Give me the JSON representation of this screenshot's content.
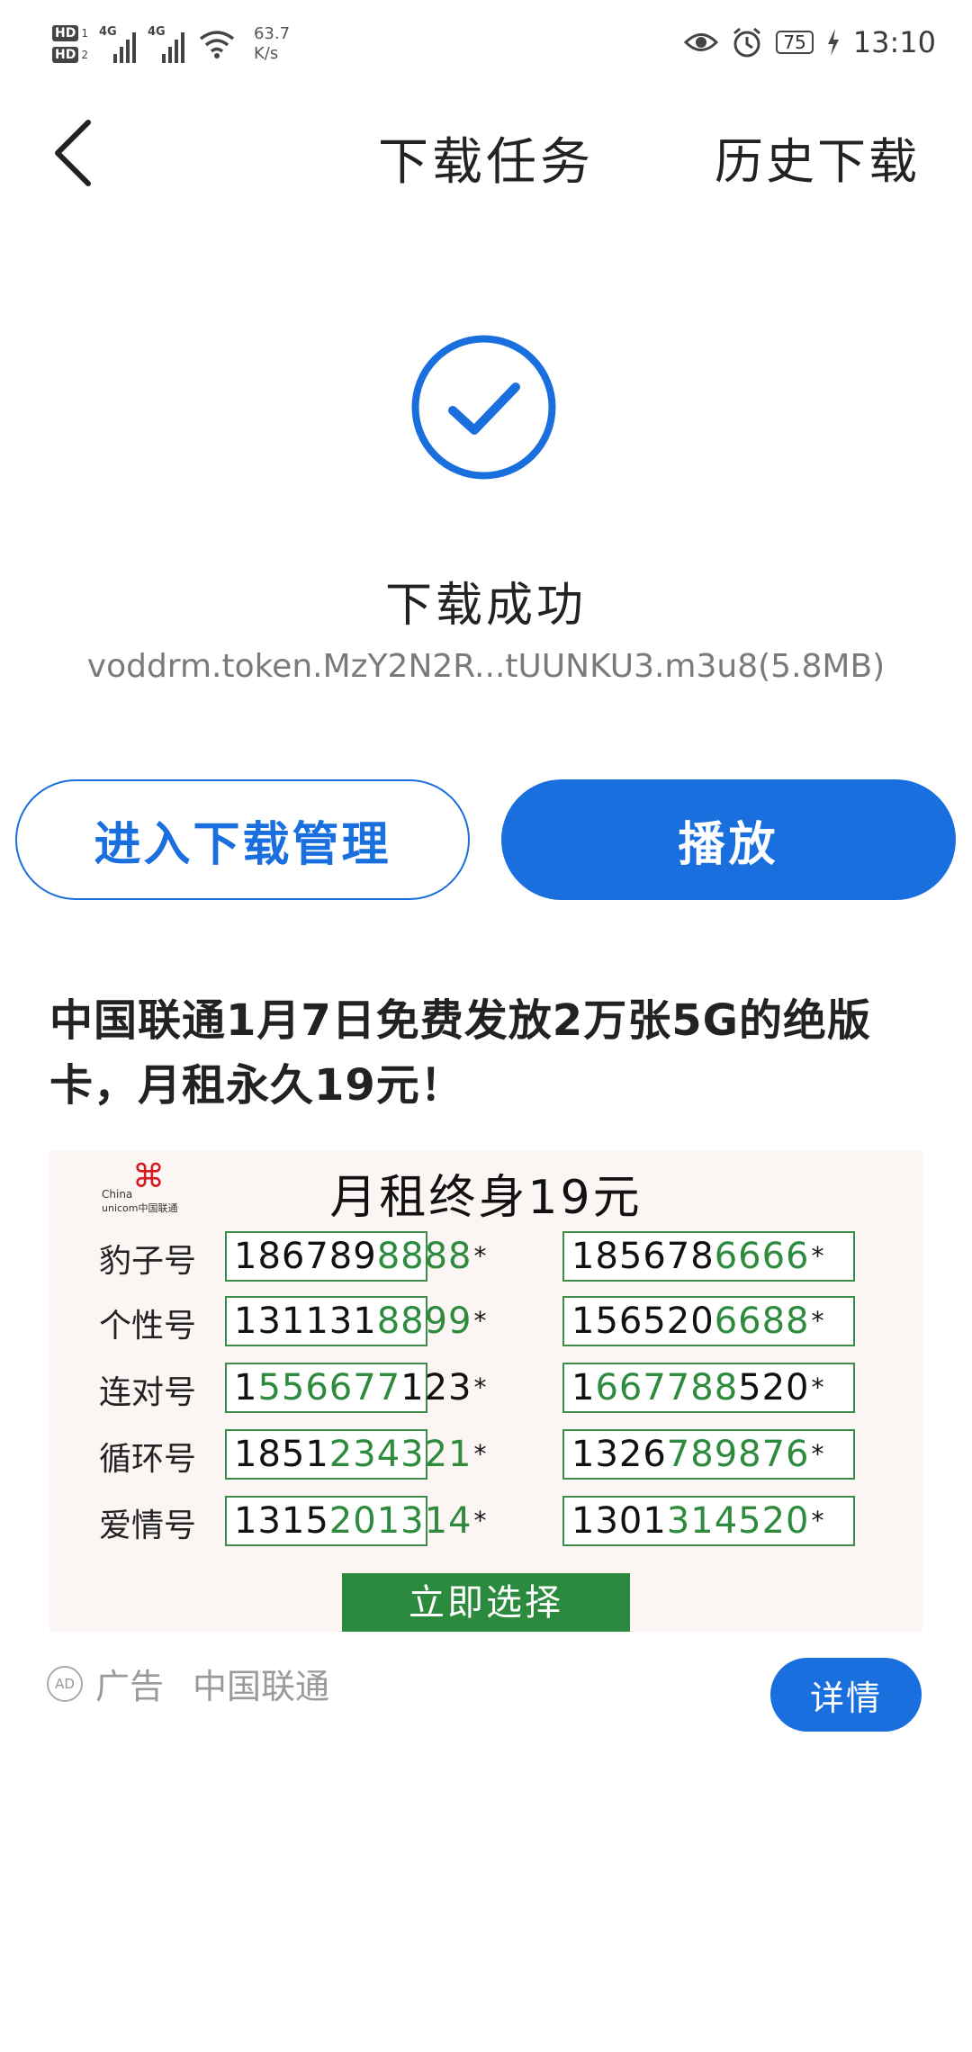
{
  "status_bar": {
    "hd1": "HD",
    "hd1_sub": "1",
    "hd2": "HD",
    "hd2_sub": "2",
    "sig1_tag": "4G",
    "sig2_tag": "4G",
    "speed_value": "63.7",
    "speed_unit": "K/s",
    "battery": "75",
    "time": "13:10",
    "icons": [
      "eye-icon",
      "alarm-icon",
      "battery-icon",
      "charging-icon",
      "wifi-icon",
      "signal-icon"
    ]
  },
  "header": {
    "title": "下载任务",
    "history": "历史下载"
  },
  "result": {
    "title": "下载成功",
    "filename": "voddrm.token.MzY2N2R...tUUNKU3.m3u8(5.8MB)"
  },
  "buttons": {
    "manage": "进入下载管理",
    "play": "播放"
  },
  "ad": {
    "title": "中国联通1月7日免费发放2万张5G的绝版卡，月租永久19元！",
    "image": {
      "logo_line1": "China",
      "logo_line2": "unicom中国联通",
      "heading": "月租终身19元",
      "rows": [
        {
          "label": "豹子号",
          "n1_a": "186789",
          "n1_b": "8888",
          "n2_a": "185678",
          "n2_b": "6666"
        },
        {
          "label": "个性号",
          "n1_a": "131131",
          "n1_b": "8899",
          "n2_a": "156520",
          "n2_b": "6688"
        },
        {
          "label": "连对号",
          "n1_a": "1",
          "n1_b": "556677",
          "n1_c": "123",
          "n2_a": "1",
          "n2_b": "667788",
          "n2_c": "520"
        },
        {
          "label": "循环号",
          "n1_a": "1851",
          "n1_b": "234321",
          "n2_a": "1326",
          "n2_b": "789876"
        },
        {
          "label": "爱情号",
          "n1_a": "1315",
          "n1_b": "201314",
          "n2_a": "1301",
          "n2_b": "314520"
        }
      ],
      "star": "*",
      "select": "立即选择"
    },
    "badge": "AD",
    "label": "广告",
    "advertiser": "中国联通",
    "detail": "详情"
  },
  "colors": {
    "primary_blue": "#1a6fdf",
    "number_green": "#2e8b3e",
    "unicom_red": "#d71a21"
  }
}
